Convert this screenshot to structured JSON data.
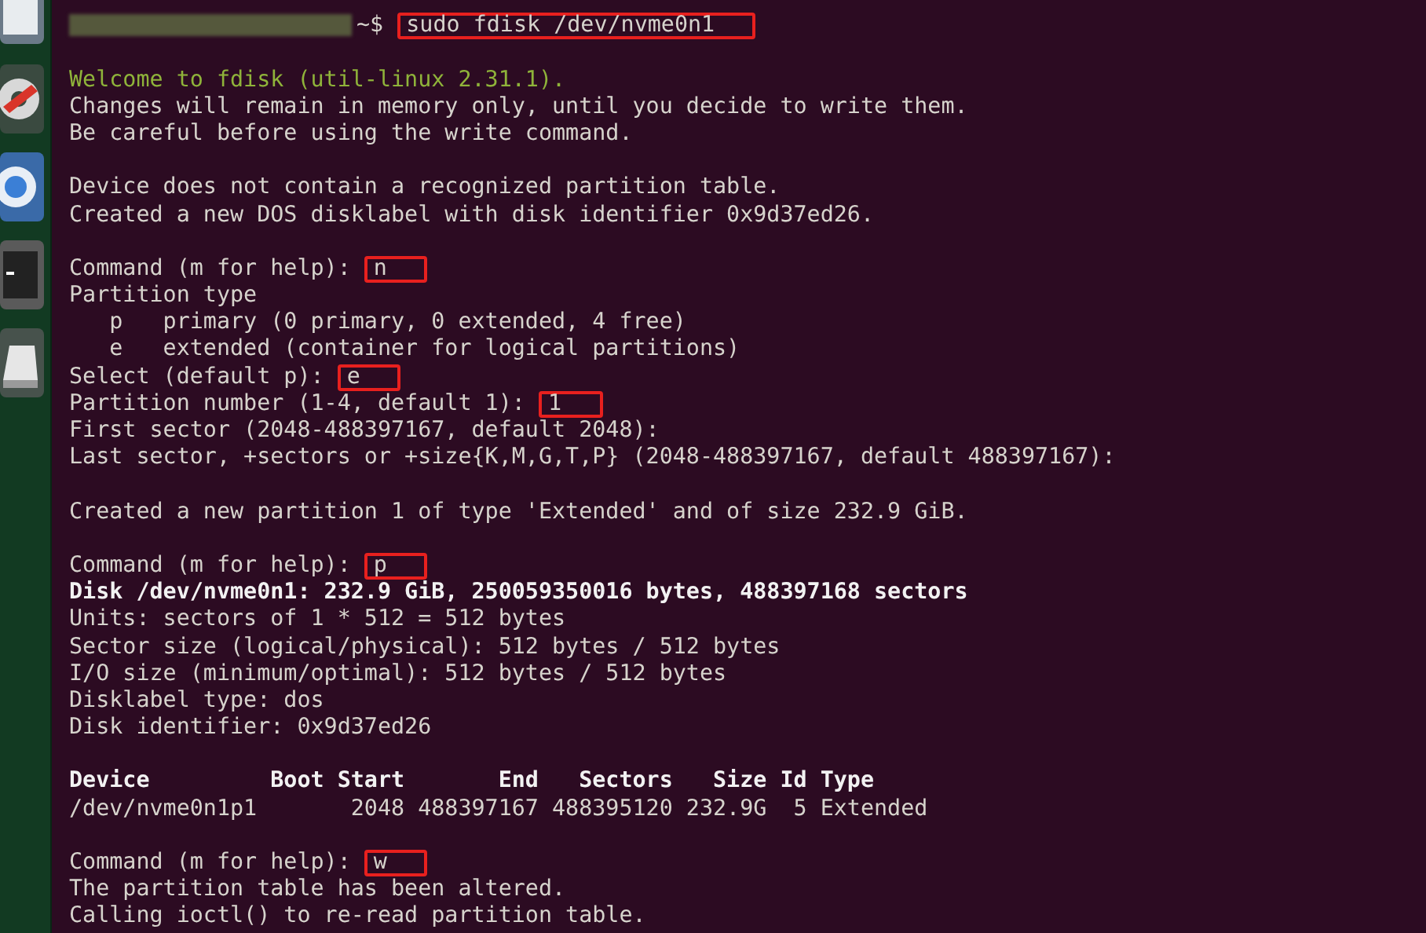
{
  "dock": {
    "items": [
      {
        "kind": "app"
      },
      {
        "kind": "settings"
      },
      {
        "kind": "browser"
      },
      {
        "kind": "terminal"
      },
      {
        "kind": "drive"
      }
    ]
  },
  "terminal": {
    "lines": [
      {
        "kind": "blank"
      },
      {
        "kind": "prompt",
        "text": "~$",
        "input": "sudo fdisk /dev/nvme0n1"
      },
      {
        "kind": "blank"
      },
      {
        "kind": "info",
        "text": "Welcome to fdisk (util-linux 2.31.1)."
      },
      {
        "kind": "text",
        "text": "Changes will remain in memory only, until you decide to write them."
      },
      {
        "kind": "text",
        "text": "Be careful before using the write command."
      },
      {
        "kind": "blank"
      },
      {
        "kind": "text",
        "text": "Device does not contain a recognized partition table."
      },
      {
        "kind": "text",
        "text": "Created a new DOS disklabel with disk identifier 0x9d37ed26."
      },
      {
        "kind": "blank"
      },
      {
        "kind": "text",
        "text": "Command (m for help):",
        "input": "n"
      },
      {
        "kind": "text",
        "text": "Partition type"
      },
      {
        "kind": "text",
        "text": "   p   primary (0 primary, 0 extended, 4 free)"
      },
      {
        "kind": "text",
        "text": "   e   extended (container for logical partitions)"
      },
      {
        "kind": "text",
        "text": "Select (default p):",
        "input": "e"
      },
      {
        "kind": "text",
        "text": "Partition number (1-4, default 1):",
        "input": "1"
      },
      {
        "kind": "text",
        "text": "First sector (2048-488397167, default 2048):"
      },
      {
        "kind": "text",
        "text": "Last sector, +sectors or +size{K,M,G,T,P} (2048-488397167, default 488397167):"
      },
      {
        "kind": "blank"
      },
      {
        "kind": "text",
        "text": "Created a new partition 1 of type 'Extended' and of size 232.9 GiB."
      },
      {
        "kind": "blank"
      },
      {
        "kind": "text",
        "text": "Command (m for help):",
        "input": "p"
      },
      {
        "kind": "bold",
        "text": "Disk /dev/nvme0n1: 232.9 GiB, 250059350016 bytes, 488397168 sectors"
      },
      {
        "kind": "text",
        "text": "Units: sectors of 1 * 512 = 512 bytes"
      },
      {
        "kind": "text",
        "text": "Sector size (logical/physical): 512 bytes / 512 bytes"
      },
      {
        "kind": "text",
        "text": "I/O size (minimum/optimal): 512 bytes / 512 bytes"
      },
      {
        "kind": "text",
        "text": "Disklabel type: dos"
      },
      {
        "kind": "text",
        "text": "Disk identifier: 0x9d37ed26"
      },
      {
        "kind": "blank"
      },
      {
        "kind": "bold",
        "text": "Device         Boot Start       End   Sectors   Size Id Type"
      },
      {
        "kind": "text",
        "text": "/dev/nvme0n1p1       2048 488397167 488395120 232.9G  5 Extended"
      },
      {
        "kind": "blank"
      },
      {
        "kind": "text",
        "text": "Command (m for help):",
        "input": "w"
      },
      {
        "kind": "text",
        "text": "The partition table has been altered."
      },
      {
        "kind": "text",
        "text": "Calling ioctl() to re-read partition table."
      }
    ]
  }
}
